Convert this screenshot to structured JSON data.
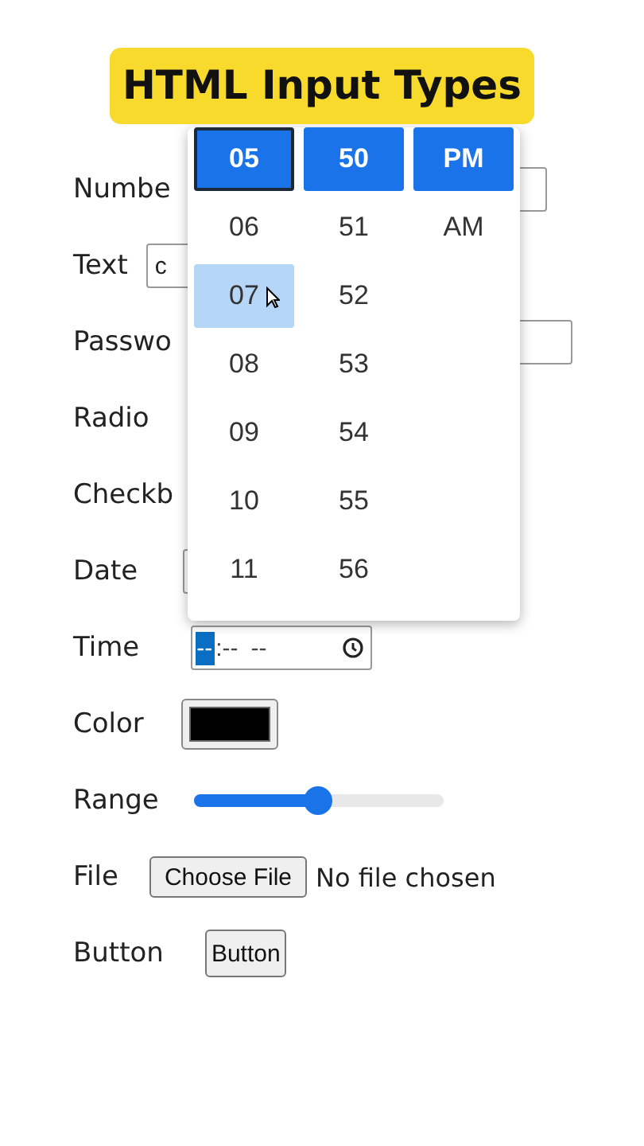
{
  "title": "HTML Input Types",
  "rows": [
    {
      "kind": "number",
      "label": "Numbe"
    },
    {
      "kind": "text",
      "label": "Text",
      "value": "c"
    },
    {
      "kind": "password",
      "label": "Passwo"
    },
    {
      "kind": "radio",
      "label": "Radio"
    },
    {
      "kind": "checkbox",
      "label": "Checkb"
    },
    {
      "kind": "date",
      "label": "Date"
    },
    {
      "kind": "time",
      "label": "Time",
      "parts": [
        {
          "text": "--",
          "selected": true
        },
        {
          "text": ":--",
          "selected": false
        },
        {
          "text": "--",
          "selected": false
        }
      ]
    },
    {
      "kind": "color",
      "label": "Color",
      "color": "#000000"
    },
    {
      "kind": "range",
      "label": "Range",
      "level": 0.5
    },
    {
      "kind": "file",
      "label": "File",
      "button": "Choose File",
      "status": "No file chosen"
    },
    {
      "kind": "button",
      "label": "Button",
      "button": "Button"
    }
  ],
  "time_picker": {
    "columns": [
      {
        "items": [
          {
            "text": "05",
            "selected": true,
            "focused": true,
            "hovered": false
          },
          {
            "text": "06",
            "selected": false,
            "focused": false,
            "hovered": false
          },
          {
            "text": "07",
            "selected": false,
            "focused": false,
            "hovered": true
          },
          {
            "text": "08",
            "selected": false,
            "focused": false,
            "hovered": false
          },
          {
            "text": "09",
            "selected": false,
            "focused": false,
            "hovered": false
          },
          {
            "text": "10",
            "selected": false,
            "focused": false,
            "hovered": false
          },
          {
            "text": "11",
            "selected": false,
            "focused": false,
            "hovered": false
          }
        ]
      },
      {
        "items": [
          {
            "text": "50",
            "selected": true,
            "focused": false,
            "hovered": false
          },
          {
            "text": "51",
            "selected": false,
            "focused": false,
            "hovered": false
          },
          {
            "text": "52",
            "selected": false,
            "focused": false,
            "hovered": false
          },
          {
            "text": "53",
            "selected": false,
            "focused": false,
            "hovered": false
          },
          {
            "text": "54",
            "selected": false,
            "focused": false,
            "hovered": false
          },
          {
            "text": "55",
            "selected": false,
            "focused": false,
            "hovered": false
          },
          {
            "text": "56",
            "selected": false,
            "focused": false,
            "hovered": false
          }
        ]
      },
      {
        "items": [
          {
            "text": "PM",
            "selected": true,
            "focused": false,
            "hovered": false
          },
          {
            "text": "AM",
            "selected": false,
            "focused": false,
            "hovered": false
          }
        ]
      }
    ]
  }
}
